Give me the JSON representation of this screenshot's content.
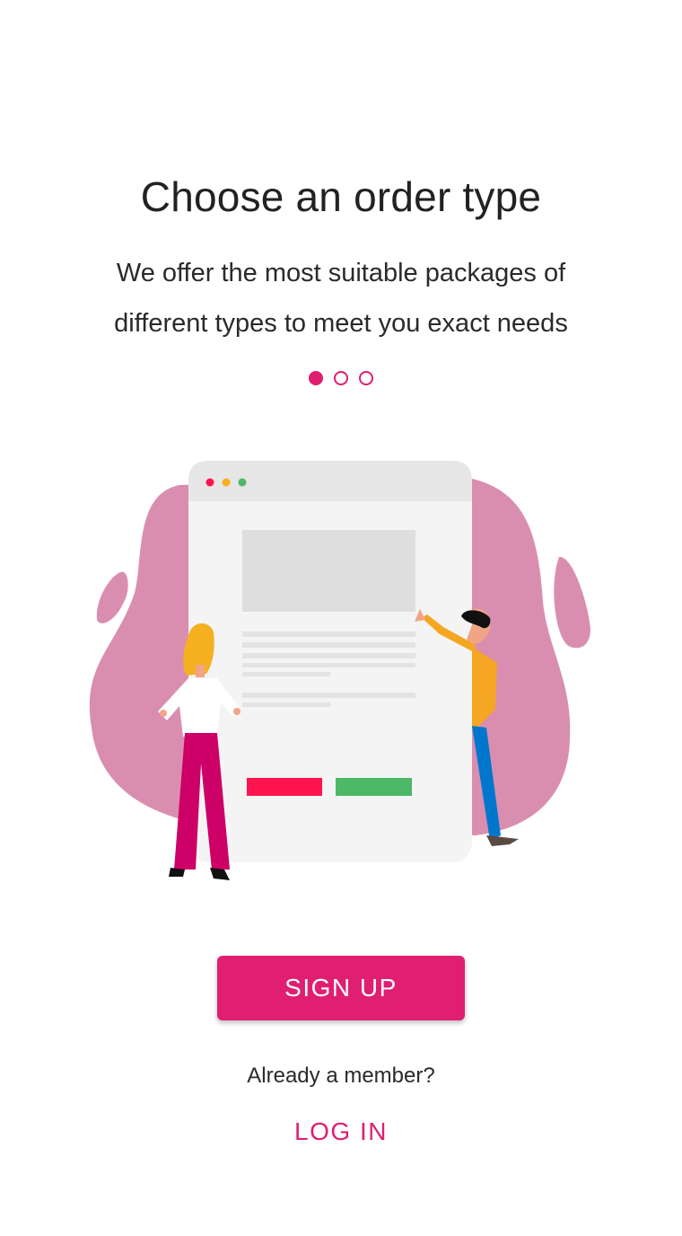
{
  "onboarding": {
    "title": "Choose an order type",
    "subtitle": "We offer the most suitable packages of different types to meet you exact needs",
    "page_indicator": {
      "total": 3,
      "active": 1
    },
    "illustration": "people-with-order-screen-illustration"
  },
  "actions": {
    "signup_label": "SIGN UP",
    "member_prompt": "Already a member?",
    "login_label": "LOG IN"
  },
  "colors": {
    "accent": "#e01e72",
    "blob": "#d98eb0",
    "red_button": "#ff1450",
    "green_button": "#4db868"
  }
}
